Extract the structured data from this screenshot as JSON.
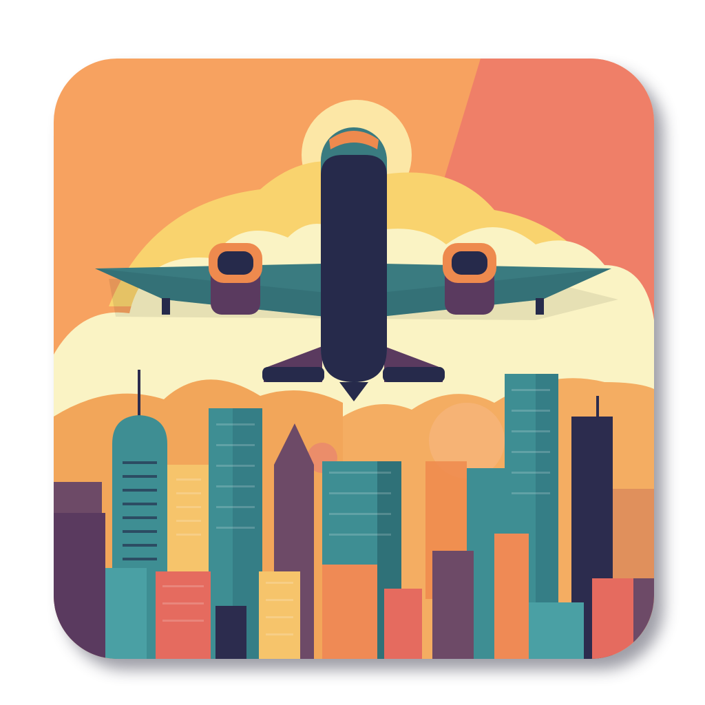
{
  "icon": {
    "subject": "airplane-over-city-skyline-icon",
    "colors": {
      "sky_orange": "#f7a260",
      "sky_coral": "#ef7f68",
      "sun_glow": "#f9d36e",
      "cloud_cream": "#faf3c4",
      "haze_orange": "#f2a65a",
      "plane_navy": "#262a4b",
      "plane_teal": "#3a7b80",
      "engine_orange": "#ee8a4e",
      "engine_purple": "#5a3a5f",
      "building_teal": "#3e8e93",
      "building_navy": "#2c2c4e",
      "building_mauve": "#6d4a67",
      "building_orange": "#ef8a55",
      "building_salmon": "#e56b5f",
      "building_yellow": "#f6c46b"
    }
  }
}
